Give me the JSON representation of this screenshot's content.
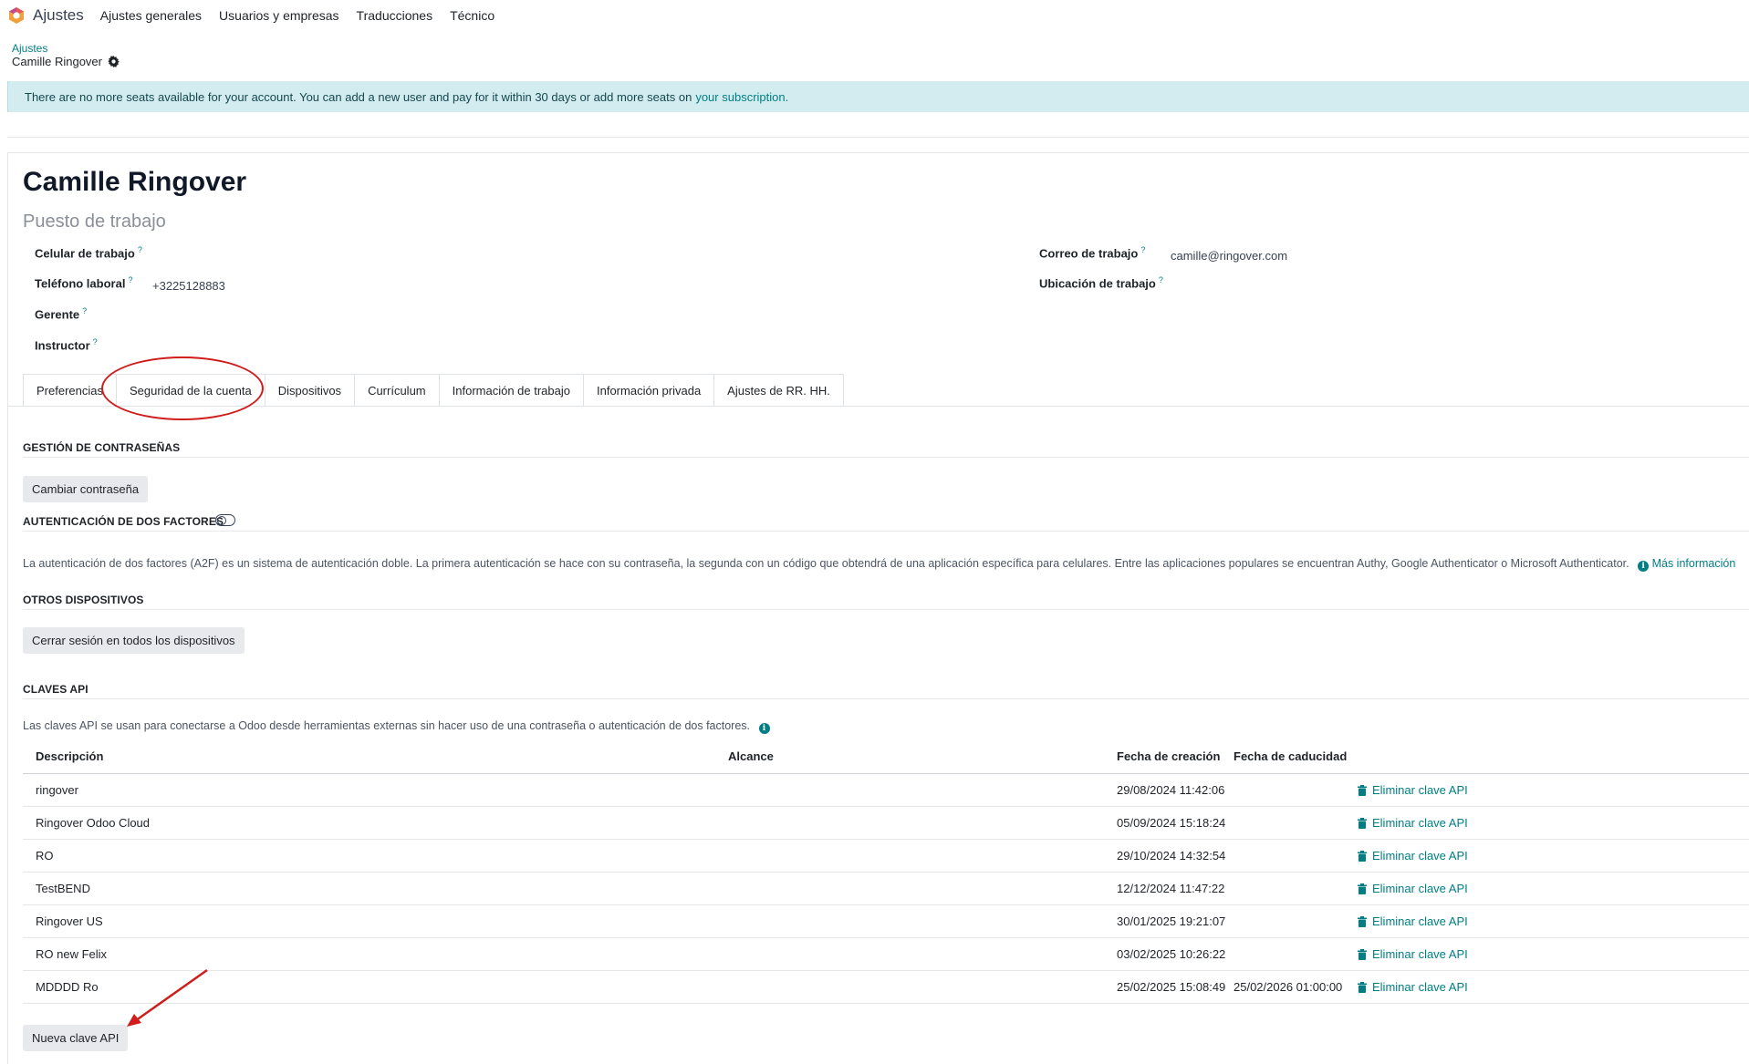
{
  "navbar": {
    "app_name": "Ajustes",
    "items": [
      "Ajustes generales",
      "Usuarios y empresas",
      "Traducciones",
      "Técnico"
    ]
  },
  "breadcrumb": {
    "parent": "Ajustes",
    "current": "Camille Ringover"
  },
  "alert": {
    "text": "There are no more seats available for your account. You can add a new user and pay for it within 30 days or add more seats on",
    "link": "your subscription."
  },
  "employee": {
    "name": "Camille Ringover",
    "job_title_placeholder": "Puesto de trabajo",
    "left_fields": [
      {
        "label": "Celular de trabajo",
        "help": "?",
        "value": ""
      },
      {
        "label": "Teléfono laboral",
        "help": "?",
        "value": "+3225128883"
      },
      {
        "label": "Gerente",
        "help": "?",
        "value": ""
      },
      {
        "label": "Instructor",
        "help": "?",
        "value": ""
      }
    ],
    "right_fields": [
      {
        "label": "Correo de trabajo",
        "help": "?",
        "value": "camille@ringover.com"
      },
      {
        "label": "Ubicación de trabajo",
        "help": "?",
        "value": ""
      }
    ]
  },
  "tabs": [
    "Preferencias",
    "Seguridad de la cuenta",
    "Dispositivos",
    "Currículum",
    "Información de trabajo",
    "Información privada",
    "Ajustes de RR. HH."
  ],
  "active_tab": "Seguridad de la cuenta",
  "security": {
    "password_title": "GESTIÓN DE CONTRASEÑAS",
    "change_password_btn": "Cambiar contraseña",
    "twofa_title": "AUTENTICACIÓN DE DOS FACTORES",
    "twofa_enabled": false,
    "twofa_text": "La autenticación de dos factores (A2F) es un sistema de autenticación doble. La primera autenticación se hace con su contraseña, la segunda con un código que obtendrá de una aplicación específica para celulares. Entre las aplicaciones populares se encuentran Authy, Google Authenticator o Microsoft Authenticator.",
    "twofa_more": "Más información",
    "devices_title": "OTROS DISPOSITIVOS",
    "logout_all_btn": "Cerrar sesión en todos los dispositivos",
    "api_title": "CLAVES API",
    "api_text": "Las claves API se usan para conectarse a Odoo desde herramientas externas sin hacer uso de una contraseña o autenticación de dos factores.",
    "api_columns": [
      "Descripción",
      "Alcance",
      "Fecha de creación",
      "Fecha de caducidad"
    ],
    "api_keys": [
      {
        "description": "ringover",
        "scope": "",
        "created": "29/08/2024 11:42:06",
        "expires": "",
        "action": "Eliminar clave API"
      },
      {
        "description": "Ringover Odoo Cloud",
        "scope": "",
        "created": "05/09/2024 15:18:24",
        "expires": "",
        "action": "Eliminar clave API"
      },
      {
        "description": "RO",
        "scope": "",
        "created": "29/10/2024 14:32:54",
        "expires": "",
        "action": "Eliminar clave API"
      },
      {
        "description": "TestBEND",
        "scope": "",
        "created": "12/12/2024 11:47:22",
        "expires": "",
        "action": "Eliminar clave API"
      },
      {
        "description": "Ringover US",
        "scope": "",
        "created": "30/01/2025 19:21:07",
        "expires": "",
        "action": "Eliminar clave API"
      },
      {
        "description": "RO new Felix",
        "scope": "",
        "created": "03/02/2025 10:26:22",
        "expires": "",
        "action": "Eliminar clave API"
      },
      {
        "description": "MDDDD Ro",
        "scope": "",
        "created": "25/02/2025 15:08:49",
        "expires": "25/02/2026 01:00:00",
        "action": "Eliminar clave API"
      }
    ],
    "new_api_key_btn": "Nueva clave API"
  },
  "colors": {
    "accent": "#017e84",
    "alert_bg": "#d3ecef",
    "annotation": "#d01c1c"
  }
}
